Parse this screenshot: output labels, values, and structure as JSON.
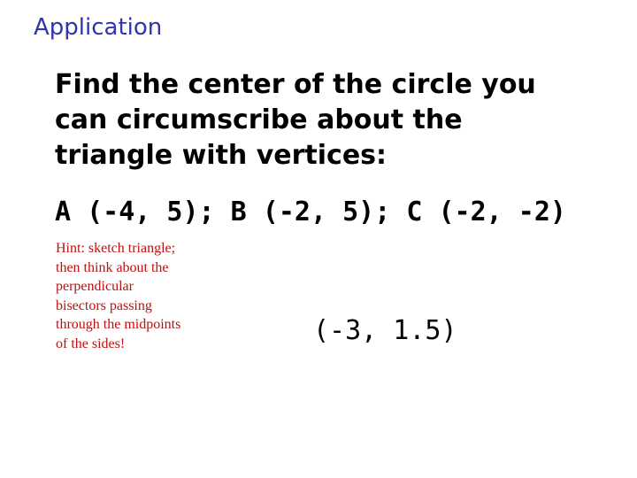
{
  "slide": {
    "title": "Application",
    "question_lines": [
      "Find the center of the circle you",
      "can circumscribe about the",
      "triangle with vertices:"
    ],
    "vertices": "A (-4, 5); B (-2, 5); C (-2, -2)",
    "hint_lines": [
      "Hint:  sketch triangle;",
      "then think about the",
      "perpendicular",
      "bisectors passing",
      "through the midpoints",
      "of the sides!"
    ],
    "answer": "(-3, 1.5)"
  },
  "colors": {
    "title": "#3333aa",
    "hint": "#bb1111",
    "body_text": "#000000"
  }
}
